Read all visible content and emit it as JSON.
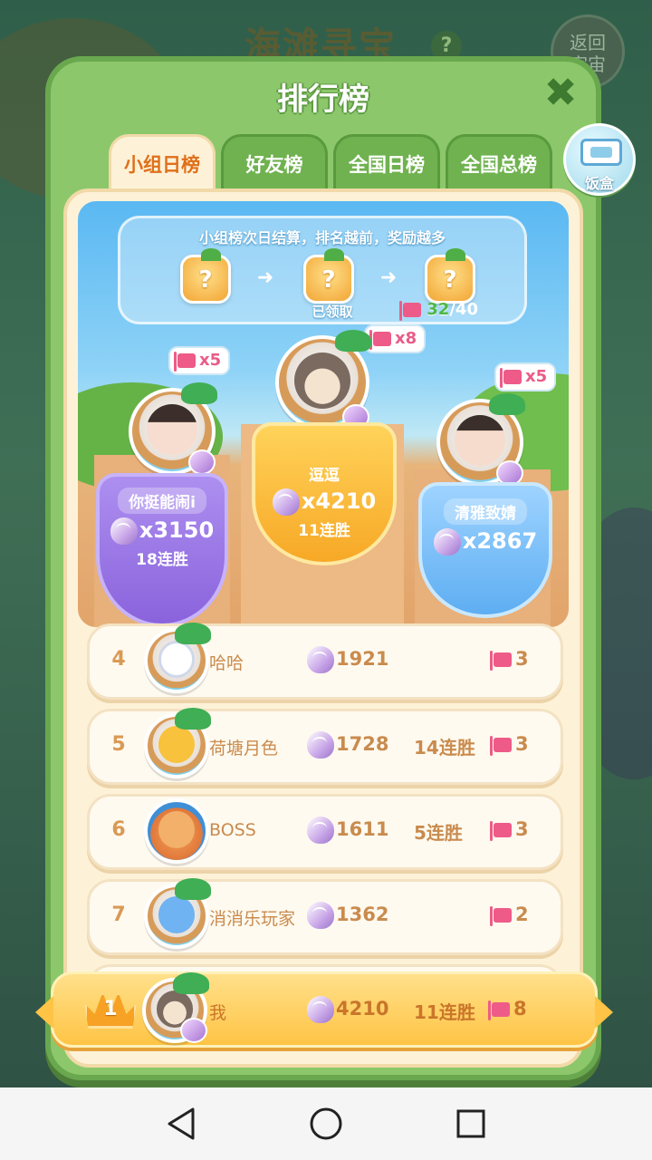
{
  "background": {
    "game_title": "海滩寻宝",
    "help_icon": "question-icon",
    "back_label": "返回\n宇宙"
  },
  "panel": {
    "title": "排行榜",
    "close_icon": "close-icon",
    "tabs": [
      {
        "label": "小组日榜",
        "active": true
      },
      {
        "label": "好友榜",
        "active": false
      },
      {
        "label": "全国日榜",
        "active": false
      },
      {
        "label": "全国总榜",
        "active": false
      }
    ],
    "lunchbox": {
      "label": "饭盒",
      "icon": "lunchbox-icon"
    }
  },
  "reward": {
    "title": "小组榜次日结算，排名越前，奖励越多",
    "claimed_label": "已领取",
    "progress_current": "32",
    "progress_total": "/40",
    "chest_icon": "mystery-chest-icon"
  },
  "podium": {
    "first": {
      "name": "逗逗",
      "score": "x4210",
      "streak": "11连胜",
      "flags": "x8"
    },
    "second": {
      "name": "你挺能闹i",
      "score": "x3150",
      "streak": "18连胜",
      "flags": "x5"
    },
    "third": {
      "name": "清雅致婧",
      "score": "x2867",
      "streak": "",
      "flags": "x5"
    }
  },
  "rows": [
    {
      "rank": "4",
      "name": "哈哈",
      "score": "1921",
      "streak": "",
      "flags": "3"
    },
    {
      "rank": "5",
      "name": "荷塘月色",
      "score": "1728",
      "streak": "14连胜",
      "flags": "3"
    },
    {
      "rank": "6",
      "name": "BOSS",
      "score": "1611",
      "streak": "5连胜",
      "flags": "3"
    },
    {
      "rank": "7",
      "name": "消消乐玩家",
      "score": "1362",
      "streak": "",
      "flags": "2"
    }
  ],
  "me": {
    "rank": "1",
    "name": "我",
    "score": "4210",
    "streak": "11连胜",
    "flags": "8"
  },
  "colors": {
    "panel_green": "#8cc86b",
    "active_tab_text": "#e06f1a",
    "gold": "#ffc445",
    "flag_pink": "#ee5b88"
  },
  "navbar": {
    "back_icon": "nav-back-icon",
    "home_icon": "nav-home-icon",
    "recents_icon": "nav-recents-icon"
  }
}
